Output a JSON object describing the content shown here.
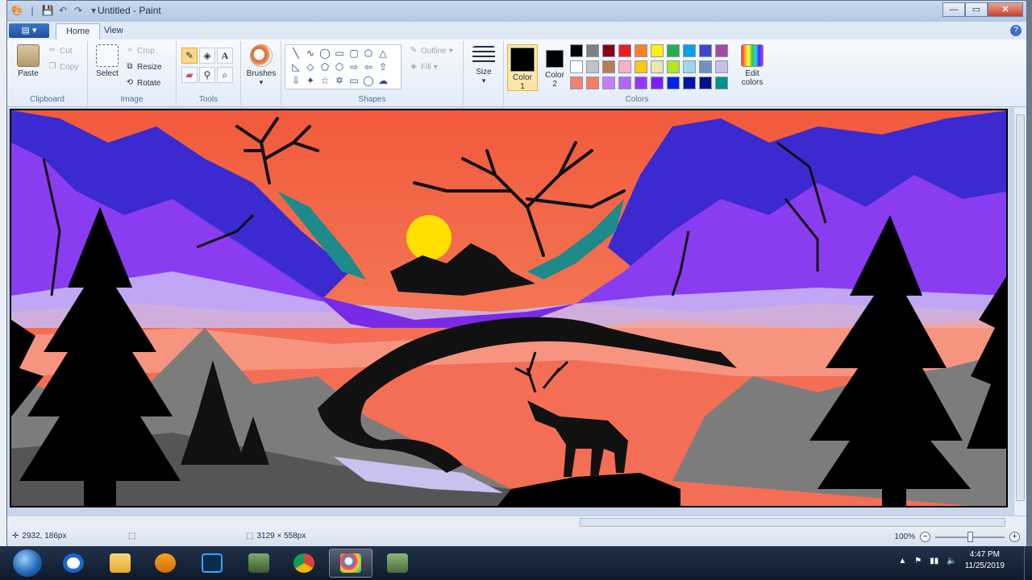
{
  "window": {
    "title": "Untitled - Paint",
    "buttons": {
      "minimize": "—",
      "maximize": "▭",
      "close": "✕"
    }
  },
  "tabs": {
    "file": "▤ ▾",
    "home": "Home",
    "view": "View"
  },
  "ribbon": {
    "clipboard": {
      "label": "Clipboard",
      "paste": "Paste",
      "cut": "Cut",
      "copy": "Copy"
    },
    "image": {
      "label": "Image",
      "select": "Select",
      "crop": "Crop",
      "resize": "Resize",
      "rotate": "Rotate"
    },
    "tools": {
      "label": "Tools"
    },
    "brushes": {
      "label": "Brushes"
    },
    "shapes": {
      "label": "Shapes",
      "outline": "Outline",
      "fill": "Fill"
    },
    "size": {
      "label": "Size"
    },
    "colors": {
      "label": "Colors",
      "color1": "Color\n1",
      "color1_line1": "Color",
      "color1_line2": "1",
      "color2_line1": "Color",
      "color2_line2": "2",
      "edit_line1": "Edit",
      "edit_line2": "colors",
      "color1_value": "#000000",
      "color2_value": "#ffffff",
      "palette": [
        "#000000",
        "#7f7f7f",
        "#880015",
        "#ed1c24",
        "#ff7f27",
        "#fff200",
        "#22b14c",
        "#00a2e8",
        "#3f48cc",
        "#a349a4",
        "#ffffff",
        "#c3c3c3",
        "#b97a57",
        "#ffaec9",
        "#ffc90e",
        "#efe4b0",
        "#b5e61d",
        "#99d9ea",
        "#7092be",
        "#c8bfe7",
        "#f08070",
        "#f47f63",
        "#c77dff",
        "#b266ff",
        "#9933ff",
        "#7a1fff",
        "#0022ee",
        "#0015a8",
        "#00118a",
        "#00918a"
      ]
    }
  },
  "status": {
    "cursor_pos": "2932, 186px",
    "canvas_size": "3129 × 558px",
    "zoom": "100%"
  },
  "taskbar": {
    "time": "4:47 PM",
    "date": "11/25/2019"
  }
}
